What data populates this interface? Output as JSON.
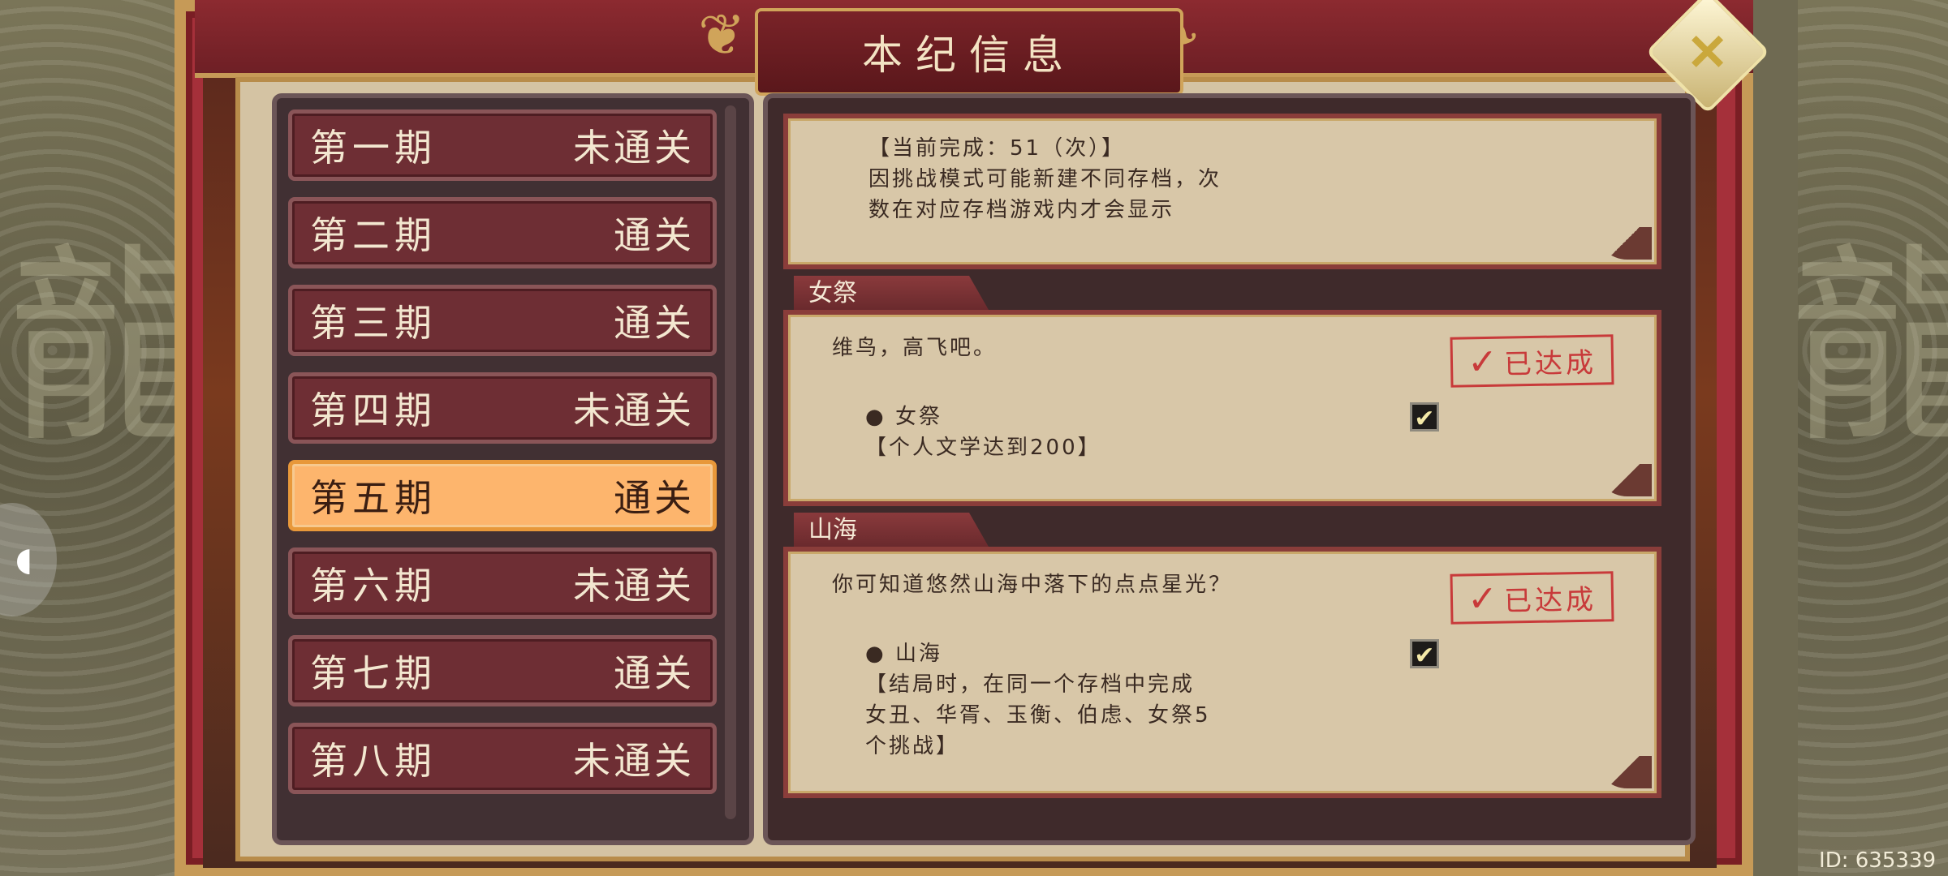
{
  "header": {
    "title": "本纪信息"
  },
  "stages": [
    {
      "label": "第一期",
      "status": "未通关"
    },
    {
      "label": "第二期",
      "status": "通关"
    },
    {
      "label": "第三期",
      "status": "通关"
    },
    {
      "label": "第四期",
      "status": "未通关"
    },
    {
      "label": "第五期",
      "status": "通关"
    },
    {
      "label": "第六期",
      "status": "未通关"
    },
    {
      "label": "第七期",
      "status": "通关"
    },
    {
      "label": "第八期",
      "status": "未通关"
    }
  ],
  "top_card": {
    "lines": [
      "【当前完成：51（次）】",
      "因挑战模式可能新建不同存档，次",
      "数在对应存档游戏内才会显示"
    ]
  },
  "achievements": [
    {
      "tab": "女祭",
      "quote": "维鸟，高飞吧。",
      "stamp": "已达成",
      "item": "● 女祭",
      "req_lines": [
        "【个人文学达到200】"
      ],
      "checked": "✔"
    },
    {
      "tab": "山海",
      "quote": "你可知道悠然山海中落下的点点星光？",
      "stamp": "已达成",
      "item": "● 山海",
      "req_lines": [
        "【结局时，在同一个存档中完成",
        "女丑、华胥、玉衡、伯虑、女祭5",
        "个挑战】"
      ],
      "checked": "✔"
    }
  ],
  "footer": {
    "id_label": "ID: 635339"
  },
  "colors": {
    "active_stage": "#fdb56d",
    "stage": "#6e2e34",
    "stamp": "#c83a3a"
  }
}
